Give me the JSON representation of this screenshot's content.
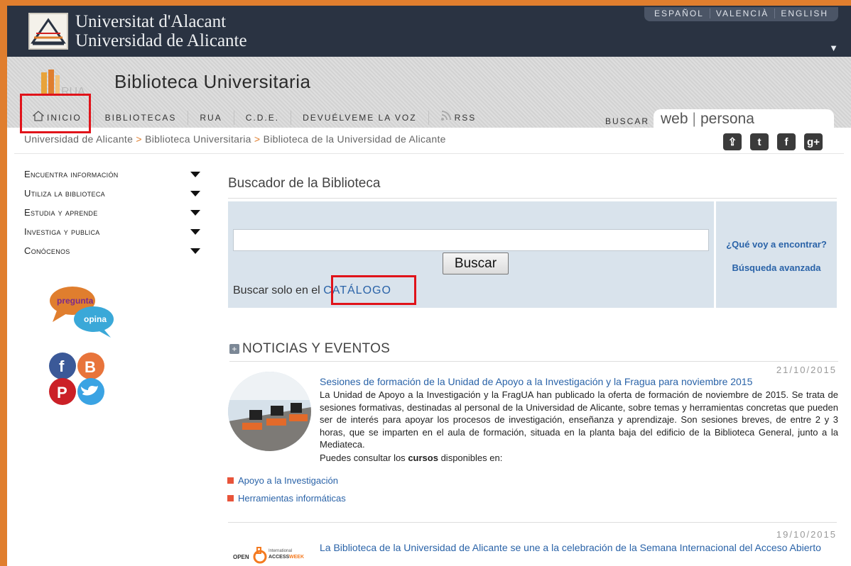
{
  "topbar": {
    "name_lines": [
      "Universitat d'Alacant",
      "Universidad de Alicante"
    ],
    "languages": [
      "ESPAÑOL",
      "VALENCIÀ",
      "ENGLISH"
    ]
  },
  "library": {
    "logo_text": "RUA",
    "title": "Biblioteca Universitaria"
  },
  "nav": {
    "items": [
      "INICIO",
      "BIBLIOTECAS",
      "RUA",
      "C.D.E.",
      "DEVUÉLVEME LA VOZ",
      "RSS"
    ],
    "search_label": "BUSCAR",
    "search_tabs": [
      "web",
      "persona"
    ]
  },
  "breadcrumb": [
    "Universidad de Alicante",
    "Biblioteca Universitaria",
    "Biblioteca de la Universidad de Alicante"
  ],
  "breadcrumb_separator": ">",
  "left_menu": [
    "Encuentra información",
    "Utiliza la biblioteca",
    "Estudia y aprende",
    "Investiga y publica",
    "Conócenos"
  ],
  "pregunta": {
    "line1": "pregunta",
    "line2": "opina"
  },
  "search": {
    "title": "Buscador de la Biblioteca",
    "input_value": "",
    "button": "Buscar",
    "solo_prefix": "Buscar solo en el",
    "solo_link": "CATÁLOGO",
    "side_links": [
      "¿Qué voy a encontrar?",
      "Búsqueda avanzada"
    ]
  },
  "news": {
    "title": "NOTICIAS Y EVENTOS",
    "items": [
      {
        "date": "21/10/2015",
        "title": "Sesiones de formación de la Unidad de Apoyo a la Investigación y la Fragua para noviembre 2015",
        "body": "La Unidad de Apoyo a la Investigación y la FragUA han publicado la oferta de formación de noviembre de 2015. Se trata de sesiones formativas, destinadas al personal de la Universidad de Alicante, sobre temas y herramientas concretas que pueden ser de interés para apoyar los procesos de investigación, enseñanza y aprendizaje. Son sesiones breves, de entre 2 y 3 horas, que se imparten en el aula de formación, situada en la planta baja del edificio de la Biblioteca General, junto a la Mediateca.",
        "consult_before": "Puedes consultar los",
        "consult_bold": "cursos",
        "consult_after": "disponibles en:",
        "links": [
          "Apoyo a la Investigación",
          "Herramientas informáticas"
        ]
      },
      {
        "date": "19/10/2015",
        "title": "La Biblioteca de la Universidad de Alicante se une a la celebración de la Semana Internacional del Acceso Abierto",
        "logo_text": [
          "OPEN",
          "International",
          "ACCESS",
          "WEEK"
        ]
      }
    ]
  },
  "colors": {
    "accent_orange": "#e07e2e",
    "link_blue": "#2a63a8",
    "highlight_red": "#e0131a",
    "topbar": "#2a3342"
  }
}
